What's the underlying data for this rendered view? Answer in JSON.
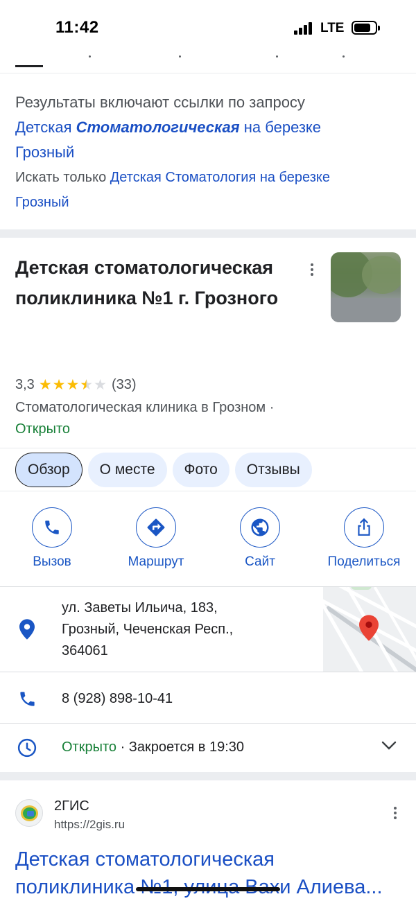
{
  "status_bar": {
    "time": "11:42",
    "network": "LTE"
  },
  "results_info": {
    "line1": "Результаты включают ссылки по запросу",
    "query_part1": "Детская",
    "query_bold": "Стоматологическая",
    "query_part2": "на березке",
    "query_part3": "Грозный",
    "search_only_label": "Искать только",
    "search_only_link_a": "Детская Стоматология на березке",
    "search_only_link_b": "Грозный"
  },
  "place": {
    "title": "Детская стоматологическая поликлиника №1 г. Грозного",
    "rating": "3,3",
    "stars": 3.3,
    "reviews_count": "(33)",
    "category": "Стоматологическая клиника в Грозном ·",
    "status": "Открыто"
  },
  "tabs": [
    {
      "label": "Обзор",
      "active": true
    },
    {
      "label": "О месте",
      "active": false
    },
    {
      "label": "Фото",
      "active": false
    },
    {
      "label": "Отзывы",
      "active": false
    }
  ],
  "actions": {
    "call": "Вызов",
    "route": "Маршрут",
    "site": "Сайт",
    "share": "Поделиться"
  },
  "details": {
    "address_line1": "ул. Заветы Ильича, 183,",
    "address_line2": "Грозный, Чеченская Респ.,",
    "address_line3": "364061",
    "phone": "8 (928) 898-10-41",
    "hours_open": "Открыто",
    "hours_close": "· Закроется в 19:30"
  },
  "result": {
    "site_name": "2ГИС",
    "url": "https://2gis.ru",
    "title_line1": "Детская стоматологическая",
    "title_line2": "поликлиника №1, улица Вахи Алиева..."
  },
  "colors": {
    "link": "#1a4fc4",
    "open_green": "#188038",
    "action_blue": "#1a56c4",
    "star": "#fbbc04",
    "map_pin": "#ea4335"
  }
}
